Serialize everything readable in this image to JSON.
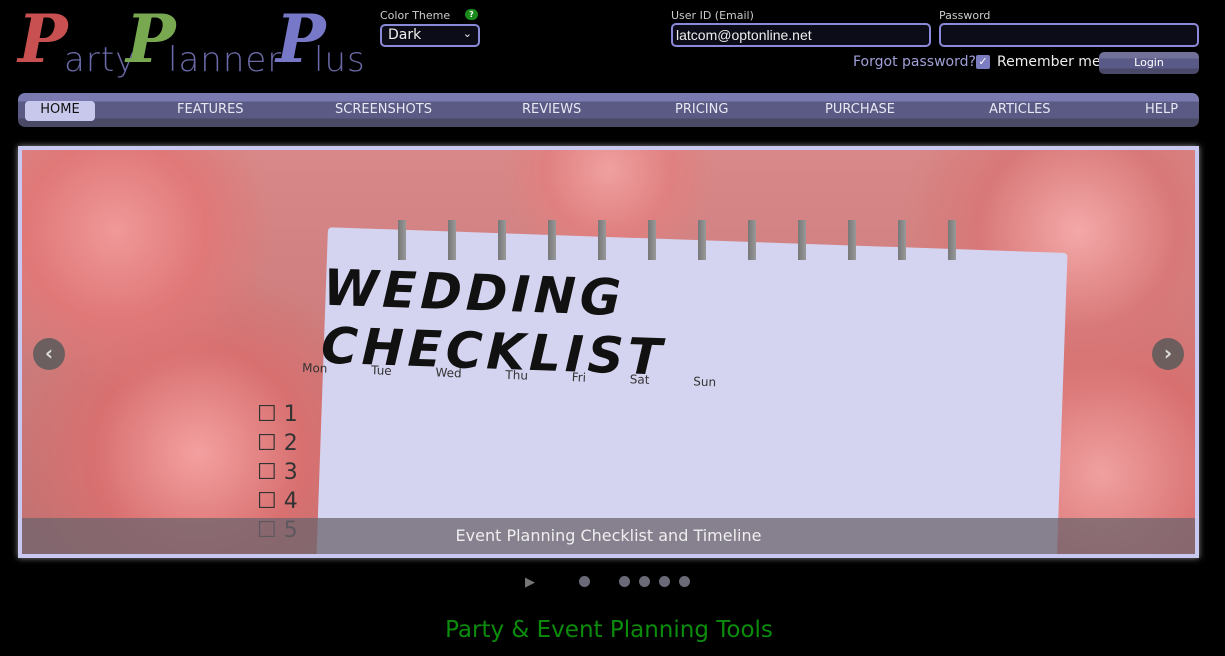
{
  "logo": {
    "text": "PartyPlannerPlus",
    "letters": [
      "P",
      "P",
      "P"
    ],
    "parts": [
      "arty",
      "lanner",
      "lus"
    ],
    "colors": [
      "#c85050",
      "#78a850",
      "#7878c8"
    ]
  },
  "theme": {
    "label": "Color Theme",
    "help": "?",
    "selected": "Dark"
  },
  "login": {
    "user_label": "User ID (Email)",
    "user_value": "latcom@optonline.net",
    "password_label": "Password",
    "password_value": "",
    "forgot": "Forgot password?",
    "remember": "Remember me",
    "remember_checked": true,
    "button": "Login"
  },
  "nav": {
    "items": [
      "HOME",
      "FEATURES",
      "SCREENSHOTS",
      "REVIEWS",
      "PRICING",
      "PURCHASE",
      "ARTICLES",
      "HELP"
    ],
    "active": "HOME"
  },
  "slideshow": {
    "image_text": "WEDDING CHECKLIST",
    "image_days": "Mon Tue Wed Thu Fri Sat Sun",
    "caption": "Event Planning Checklist and Timeline",
    "prev": "‹",
    "next": "›",
    "slide_count": 5,
    "active_slide": 1
  },
  "section": {
    "heading": "Party & Event Planning Tools",
    "color": "#0c8c0c"
  }
}
